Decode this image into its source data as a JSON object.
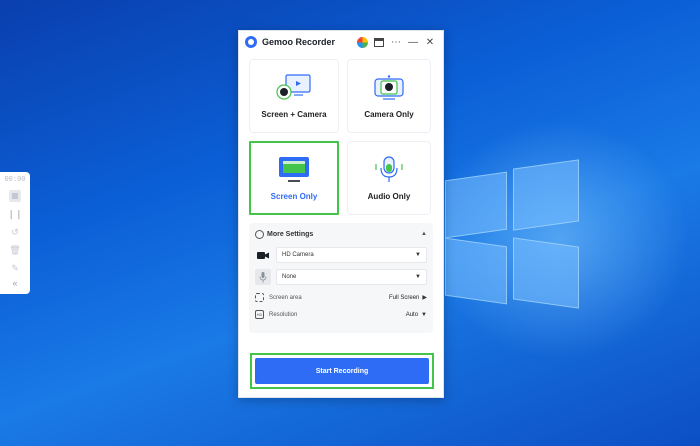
{
  "app": {
    "title": "Gemoo Recorder",
    "icons": [
      "browser-icon",
      "window-icon",
      "more-icon",
      "minimize-icon",
      "close-icon"
    ]
  },
  "toolbar": {
    "timer": "00:00",
    "collapse": "«",
    "icons": [
      "stop-icon",
      "pause-icon",
      "restart-icon",
      "delete-icon",
      "pen-icon"
    ]
  },
  "modes": [
    {
      "label": "Screen + Camera",
      "icon": "screen-camera-icon",
      "selected": false
    },
    {
      "label": "Camera Only",
      "icon": "camera-only-icon",
      "selected": false
    },
    {
      "label": "Screen Only",
      "icon": "screen-only-icon",
      "selected": true
    },
    {
      "label": "Audio Only",
      "icon": "microphone-icon",
      "selected": false
    }
  ],
  "settings": {
    "title": "More Settings",
    "camera": "HD Camera",
    "microphone": "None",
    "screen_area_label": "Screen area",
    "screen_area_value": "Full Screen",
    "resolution_label": "Resolution",
    "resolution_value": "Auto",
    "hd_badge": "HD"
  },
  "start_button": "Start Recording",
  "colors": {
    "accent": "#2f6cf5",
    "highlight": "#43c44a",
    "desktop": "#0b5fd6"
  }
}
